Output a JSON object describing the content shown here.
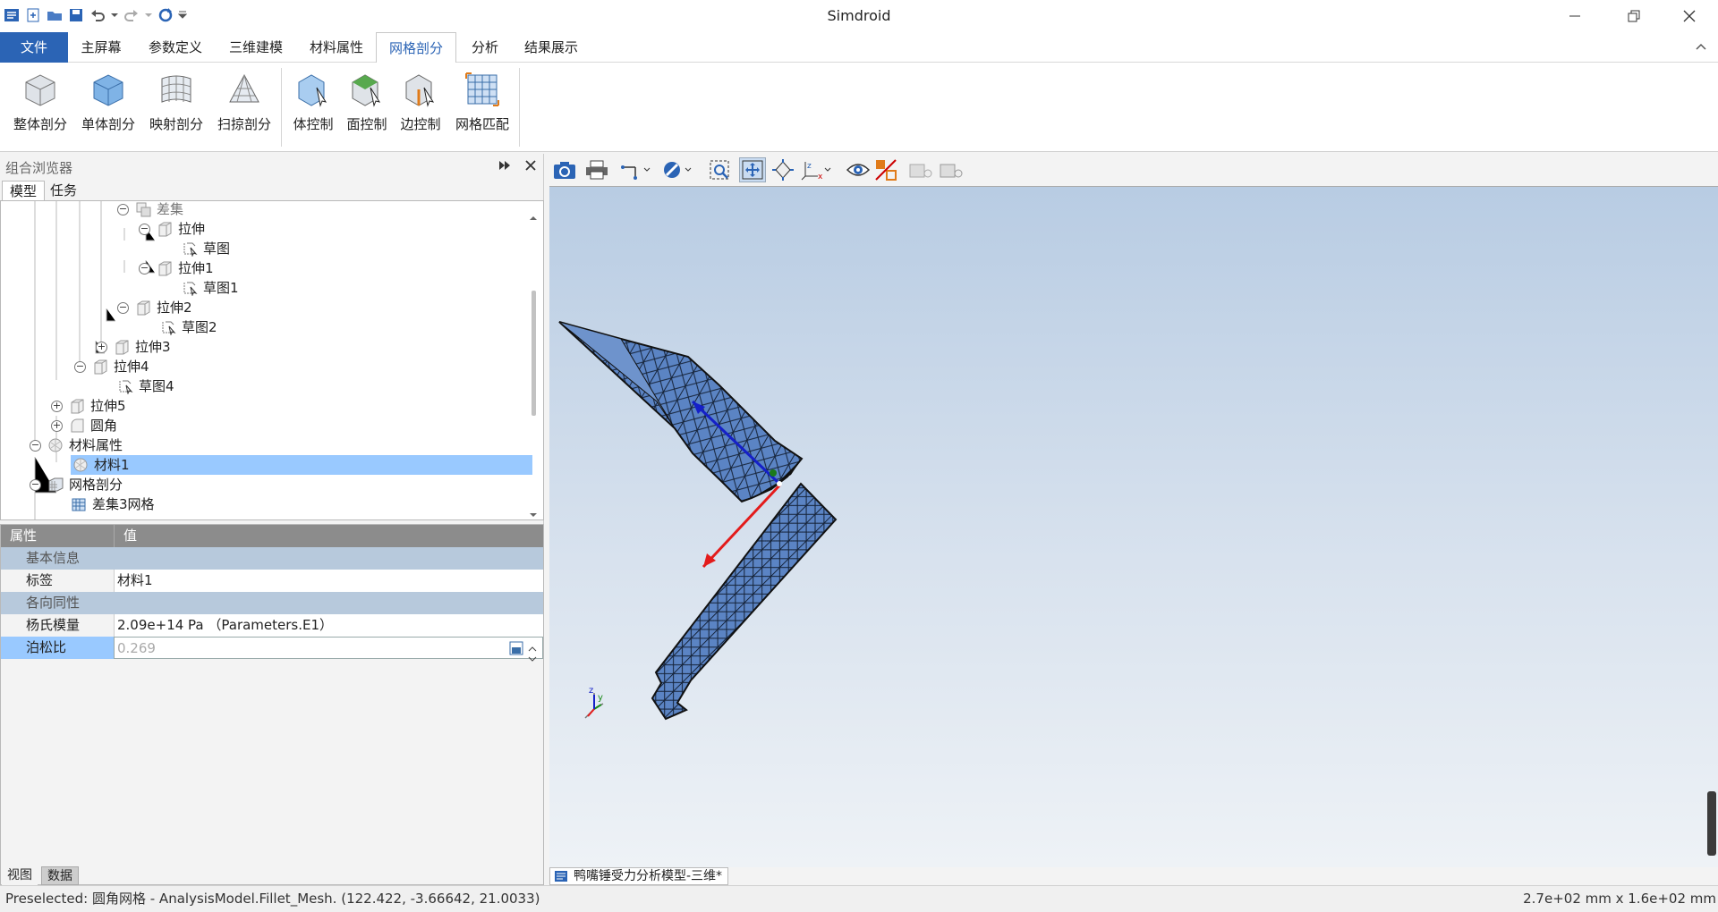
{
  "app": {
    "title": "Simdroid"
  },
  "ribbon_tabs": [
    "文件",
    "主屏幕",
    "参数定义",
    "三维建模",
    "材料属性",
    "网格剖分",
    "分析",
    "结果展示"
  ],
  "ribbon_buttons": {
    "group1": [
      "整体剖分",
      "单体剖分",
      "映射剖分",
      "扫掠剖分"
    ],
    "group2": [
      "体控制",
      "面控制",
      "边控制",
      "网格匹配"
    ]
  },
  "panel": {
    "title": "组合浏览器",
    "tabs": [
      "模型",
      "任务"
    ]
  },
  "tree": [
    "差集",
    "拉伸",
    "草图",
    "拉伸1",
    "草图1",
    "拉伸2",
    "草图2",
    "拉伸3",
    "拉伸4",
    "草图4",
    "拉伸5",
    "圆角",
    "材料属性",
    "材料1",
    "网格剖分",
    "差集3网格"
  ],
  "properties": {
    "header_key": "属性",
    "header_value": "值",
    "cat_basic": "基本信息",
    "label_key": "标签",
    "label_value": "材料1",
    "cat_iso": "各向同性",
    "young_key": "杨氏模量",
    "young_value": "2.09e+14 Pa （Parameters.E1）",
    "poisson_key": "泊松比",
    "poisson_value": "0.269"
  },
  "bottom_tabs": [
    "视图",
    "数据"
  ],
  "document_tab": "鸭嘴锤受力分析模型-三维*",
  "status": {
    "left": "Preselected: 圆角网格 - AnalysisModel.Fillet_Mesh. (122.422, -3.66642, 21.0033)",
    "right": "2.7e+02 mm x 1.6e+02 mm"
  },
  "colors": {
    "accent": "#2b64b5",
    "mesh": "#5b84c4",
    "selection": "#99c9ff"
  },
  "icons": [
    "app-icon",
    "new-icon",
    "open-icon",
    "save-icon",
    "undo-icon",
    "redo-icon",
    "refresh-icon",
    "camera-icon",
    "print-icon",
    "eye-icon"
  ]
}
